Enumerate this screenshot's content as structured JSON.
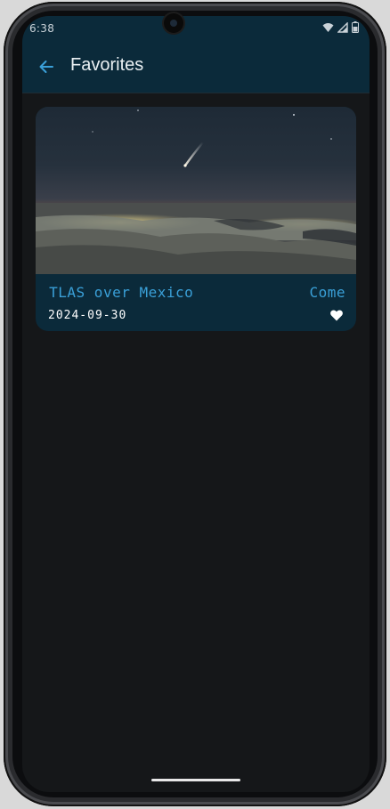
{
  "status_bar": {
    "time": "6:38",
    "icons": [
      "wifi-icon",
      "signal-icon",
      "battery-icon"
    ]
  },
  "app_bar": {
    "title": "Favorites",
    "back_icon": "arrow-back-icon"
  },
  "favorites": [
    {
      "title_lead": ".",
      "title": "TLAS over Mexico",
      "type": "Come",
      "date": "2024-09-30",
      "favorited": true,
      "favorite_icon": "heart-icon"
    }
  ],
  "colors": {
    "app_bar_bg": "#0b2a3a",
    "screen_bg": "#151719",
    "accent": "#3aa0d8",
    "card_bg": "#0b2a3a",
    "text_primary": "#eaf0f3"
  }
}
